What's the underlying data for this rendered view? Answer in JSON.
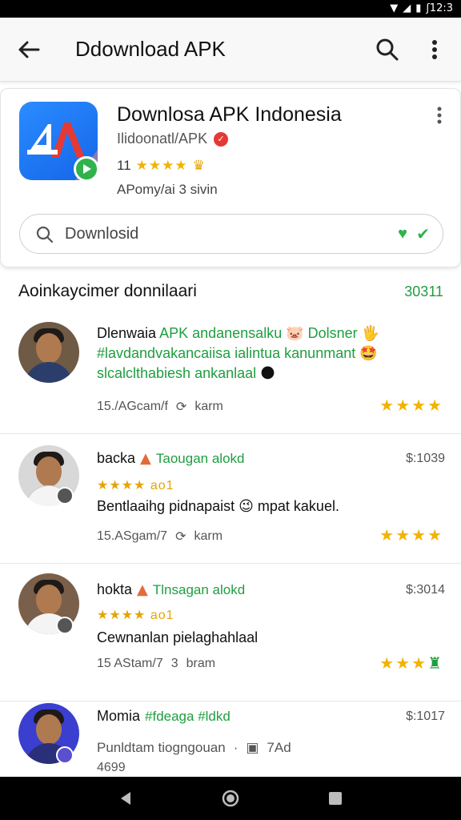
{
  "status_bar": {
    "time": "ʃ12:3"
  },
  "app_bar": {
    "title": "Ddownload APK",
    "back_icon": "arrow-left-icon",
    "search_icon": "search-icon",
    "more_icon": "more-vert-icon"
  },
  "app": {
    "name": "Downlosa APK Indonesia",
    "developer": "Ilidoonatl/APK",
    "rating": "11",
    "meta": "APomy/ai 3 sivin",
    "search_text": "Downlosid"
  },
  "section": {
    "title": "Aoinkaycimer donnilaari",
    "count": "30311"
  },
  "reviews": [
    {
      "line1a": "Dlenwaia",
      "line1b": "APK",
      "line1c": "andanensalku 🐷 Dolsner 🖐",
      "line2": "#lavdandvakancaiisa ialintua kanunmant 🤩",
      "line3": "slcalclthabiesh ankanlaal",
      "date": "15./AGcam/f",
      "reply": "karm",
      "stars": "★★★★"
    },
    {
      "name": "backa",
      "tag": "Taougan alokd",
      "sub": "★★★★ ao1",
      "text": "Bentlaaihg pidnapaist 😉 mpat kakuel.",
      "date": "15.ASgam/7",
      "reply": "karm",
      "price": "$:1039",
      "stars": "★★★★"
    },
    {
      "name": "hokta",
      "tag": "Tlnsagan alokd",
      "sub": "★★★★ ao1",
      "text": "Cewnanlan pielaghahlaal",
      "date": "15 AStam/7",
      "reply": "bram",
      "price": "$:3014",
      "stars": "★★★"
    },
    {
      "name": "Momia",
      "tag": "#fdeaga #ldkd",
      "text": "Punldtam tiogngouan",
      "extra": "7Ad",
      "number": "4699",
      "price": "$:1017"
    }
  ],
  "colors": {
    "accent_green": "#1e9e3f",
    "star_gold": "#f2b300",
    "icon_blue": "#1e6fff"
  }
}
